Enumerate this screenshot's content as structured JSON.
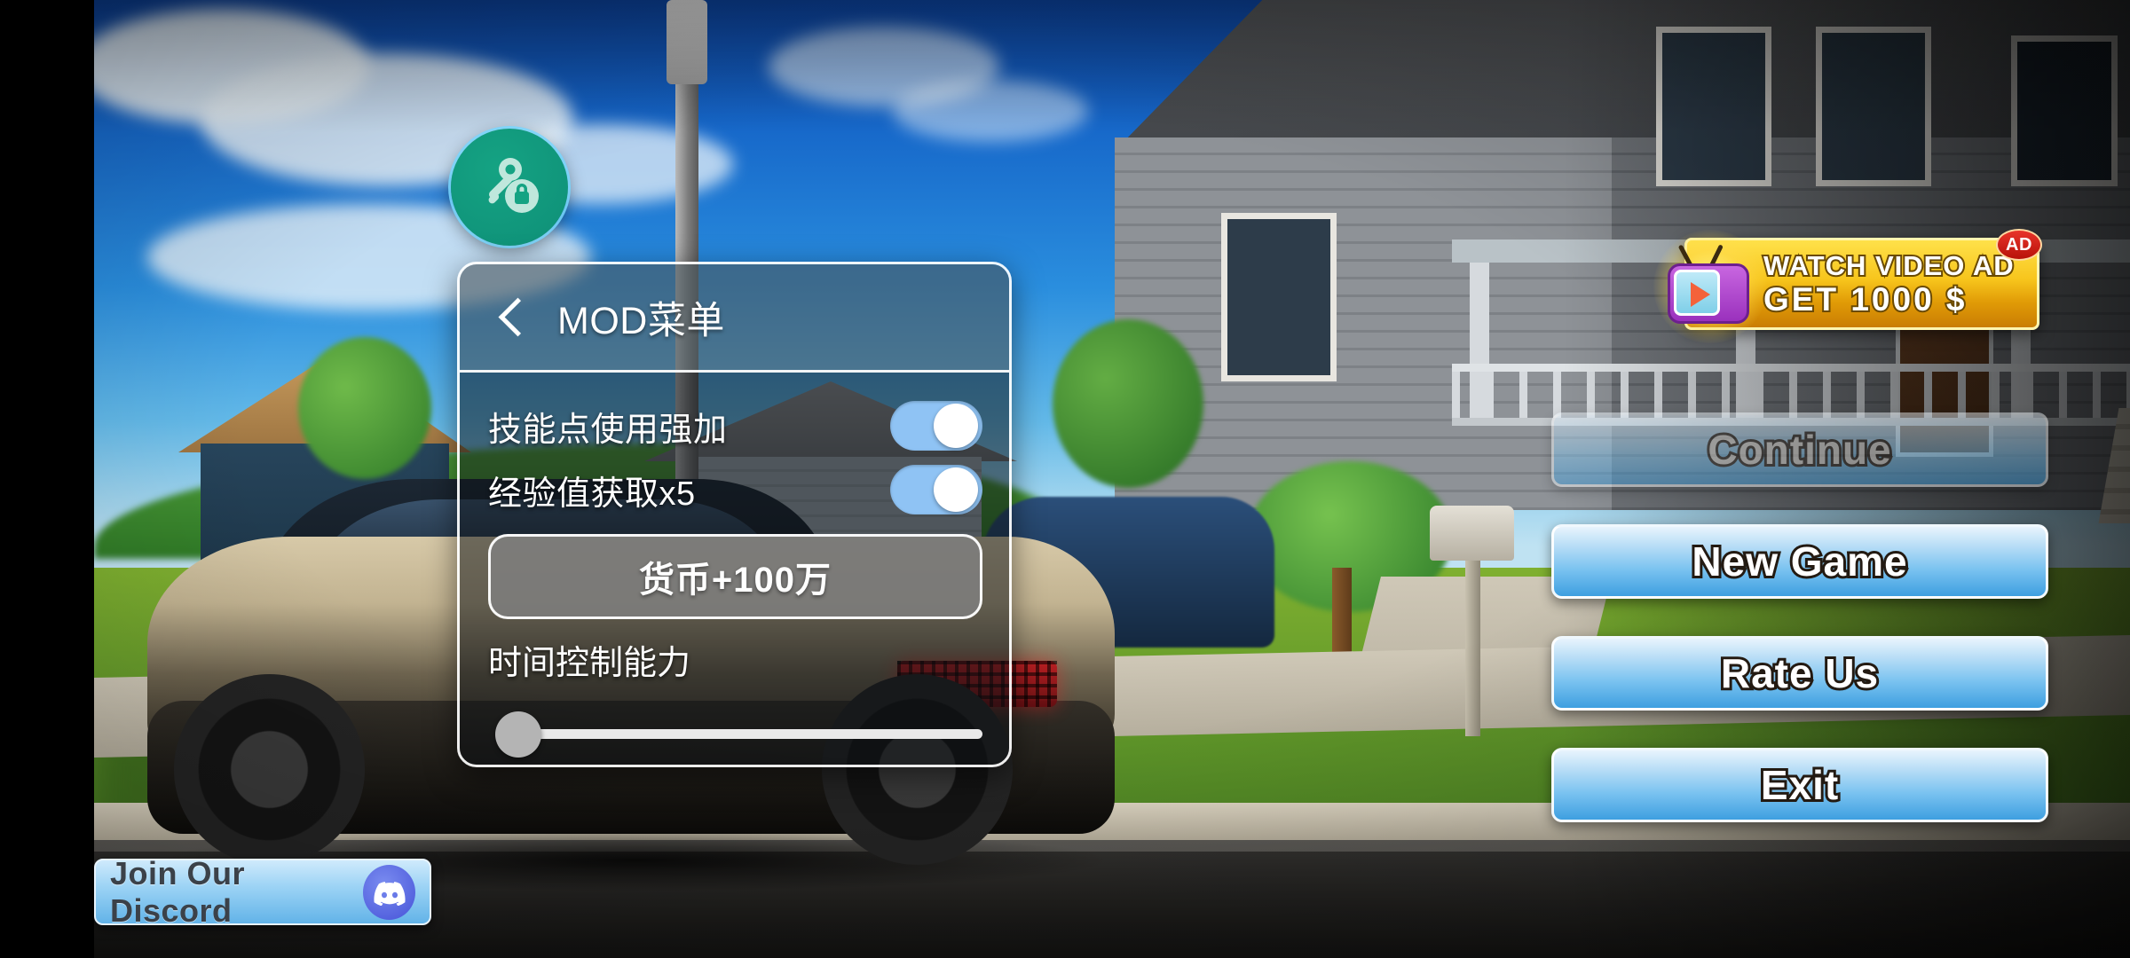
{
  "mod_fab": {
    "icon": "key-lock-icon"
  },
  "mod_menu": {
    "back_icon": "back-chevron-icon",
    "title": "MOD菜单",
    "toggles": [
      {
        "label": "技能点使用强加",
        "state": "on"
      },
      {
        "label": "经验值获取x5",
        "state": "on"
      }
    ],
    "action_button": "货币+100万",
    "slider": {
      "label": "时间控制能力",
      "value": 0,
      "min": 0,
      "max": 100
    },
    "colors": {
      "toggle_on": "#8fc3f4",
      "knob": "#ffffff",
      "panel_border": "#ffffff"
    }
  },
  "ad_banner": {
    "icon": "tv-play-icon",
    "line1": "WATCH VIDEO AD",
    "line2": "GET 1000 $",
    "badge": "AD",
    "colors": {
      "bg_top": "#ffe14a",
      "bg_bottom": "#c97d04",
      "badge": "#e8342a"
    }
  },
  "main_menu": {
    "buttons": [
      {
        "label": "Continue",
        "state": "disabled"
      },
      {
        "label": "New Game",
        "state": "enabled"
      },
      {
        "label": "Rate Us",
        "state": "enabled"
      },
      {
        "label": "Exit",
        "state": "enabled"
      }
    ],
    "colors": {
      "button_top": "#e8f4fd",
      "button_bottom": "#3e9fe0"
    }
  },
  "discord": {
    "label": "Join Our Discord",
    "icon": "discord-logo-icon"
  }
}
